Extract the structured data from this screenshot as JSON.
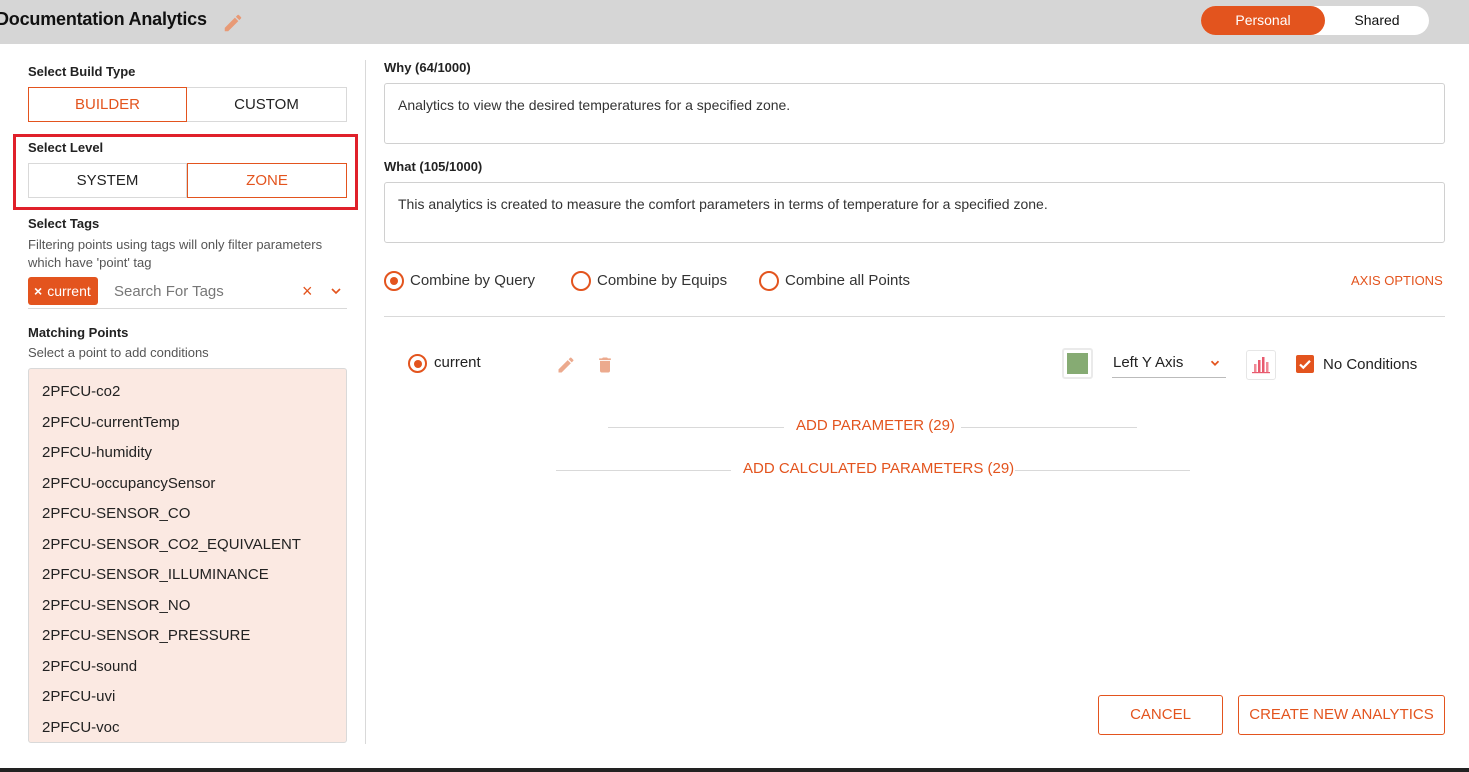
{
  "header": {
    "title": "Documentation Analytics",
    "toggle": {
      "active": "Personal",
      "inactive": "Shared"
    }
  },
  "left": {
    "build_type": {
      "label": "Select Build Type",
      "options": [
        "BUILDER",
        "CUSTOM"
      ],
      "selected": "BUILDER"
    },
    "level": {
      "label": "Select Level",
      "options": [
        "SYSTEM",
        "ZONE"
      ],
      "selected": "ZONE"
    },
    "tags": {
      "label": "Select Tags",
      "help": "Filtering points using tags will only filter parameters which have 'point' tag",
      "chip": "current",
      "placeholder": "Search For Tags"
    },
    "matching": {
      "title": "Matching Points",
      "subtitle": "Select a point to add conditions",
      "points": [
        "2PFCU-co2",
        "2PFCU-currentTemp",
        "2PFCU-humidity",
        "2PFCU-occupancySensor",
        "2PFCU-SENSOR_CO",
        "2PFCU-SENSOR_CO2_EQUIVALENT",
        "2PFCU-SENSOR_ILLUMINANCE",
        "2PFCU-SENSOR_NO",
        "2PFCU-SENSOR_PRESSURE",
        "2PFCU-sound",
        "2PFCU-uvi",
        "2PFCU-voc"
      ]
    }
  },
  "main": {
    "why": {
      "label": "Why (64/1000)",
      "value": "Analytics to view the desired temperatures for a specified zone."
    },
    "what": {
      "label": "What (105/1000)",
      "value": "This analytics is created to measure the comfort parameters in terms of temperature for a specified zone."
    },
    "combine": {
      "options": [
        "Combine by Query",
        "Combine by Equips",
        "Combine all Points"
      ],
      "selected": "Combine by Query"
    },
    "axis_options": "AXIS OPTIONS",
    "parameter": {
      "name": "current",
      "color": "#86ab73",
      "axis": "Left Y Axis",
      "no_conditions_label": "No Conditions",
      "no_conditions_checked": true
    },
    "add_parameter": "ADD PARAMETER (29)",
    "add_calculated": "ADD CALCULATED PARAMETERS (29)",
    "cancel": "CANCEL",
    "create": "CREATE NEW ANALYTICS"
  },
  "colors": {
    "accent": "#e3541e",
    "highlight": "#e0202a",
    "list_bg": "#fbe9e2"
  },
  "icons": [
    "pencil-icon",
    "trash-icon",
    "chevron-down-icon",
    "bar-chart-icon",
    "check-icon",
    "close-icon"
  ]
}
